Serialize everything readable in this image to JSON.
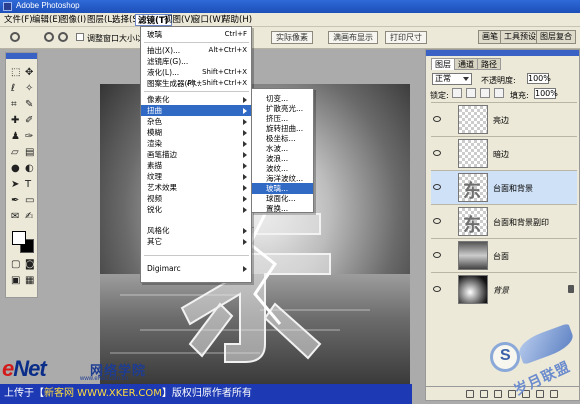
{
  "window": {
    "title": "Adobe Photoshop"
  },
  "menubar": {
    "items": [
      "文件(F)",
      "编辑(E)",
      "图像(I)",
      "图层(L)",
      "选择(S)",
      "滤镜(T)",
      "视图(V)",
      "窗口(W)",
      "帮助(H)"
    ],
    "active_index": 5
  },
  "options": {
    "checkbox_label": "调整窗口大小以满屏",
    "buttons": [
      "实际像素",
      "满画布显示",
      "打印尺寸"
    ],
    "palette_tabs": [
      "画笔",
      "工具预设",
      "图层复合"
    ]
  },
  "filter_menu": {
    "top_items": [
      {
        "label": "玻璃",
        "shortcut": "Ctrl+F"
      },
      {
        "label": "抽出(X)...",
        "shortcut": "Alt+Ctrl+X"
      },
      {
        "label": "滤镜库(G)...",
        "shortcut": ""
      },
      {
        "label": "液化(L)...",
        "shortcut": "Shift+Ctrl+X"
      },
      {
        "label": "图案生成器(P)...",
        "shortcut": "Alt+Shift+Ctrl+X"
      }
    ],
    "sub_items": [
      "像素化",
      "扭曲",
      "杂色",
      "模糊",
      "渲染",
      "画笔描边",
      "素描",
      "纹理",
      "艺术效果",
      "视频",
      "锐化",
      "风格化",
      "其它"
    ],
    "highlighted_sub": 1,
    "bottom_item": "Digimarc"
  },
  "distort_submenu": {
    "items": [
      "切变...",
      "扩散亮光...",
      "挤压...",
      "旋转扭曲...",
      "极坐标...",
      "水波...",
      "波浪...",
      "波纹...",
      "海洋波纹...",
      "玻璃...",
      "球面化...",
      "置换..."
    ],
    "highlighted_index": 9
  },
  "canvas": {
    "glyph": "东"
  },
  "layers_panel": {
    "tabs": [
      "图层",
      "通道",
      "路径"
    ],
    "blend_mode": "正常",
    "opacity_label": "不透明度:",
    "opacity_value": "100%",
    "lock_label": "锁定:",
    "fill_label": "填充:",
    "fill_value": "100%",
    "layers": [
      {
        "name": "亮边",
        "selected": false,
        "thumb": "checker"
      },
      {
        "name": "暗边",
        "selected": false,
        "thumb": "checker"
      },
      {
        "name": "台面和背景",
        "selected": true,
        "thumb": "glyph"
      },
      {
        "name": "台面和背景副印",
        "selected": false,
        "thumb": "glyph"
      },
      {
        "name": "台面",
        "selected": false,
        "thumb": "grad"
      },
      {
        "name": "背景",
        "selected": false,
        "thumb": "dark",
        "italic": true
      }
    ]
  },
  "watermark": {
    "logo": "eNet",
    "logo_cn": "网络学院",
    "url": "www.eNet.com.cn",
    "footer_pre": "上传于【",
    "footer_site": "新客网 WWW.XKER.COM",
    "footer_post": "】版权归原作者所有"
  },
  "stamp": {
    "letter": "S",
    "text": "岁月联盟"
  }
}
